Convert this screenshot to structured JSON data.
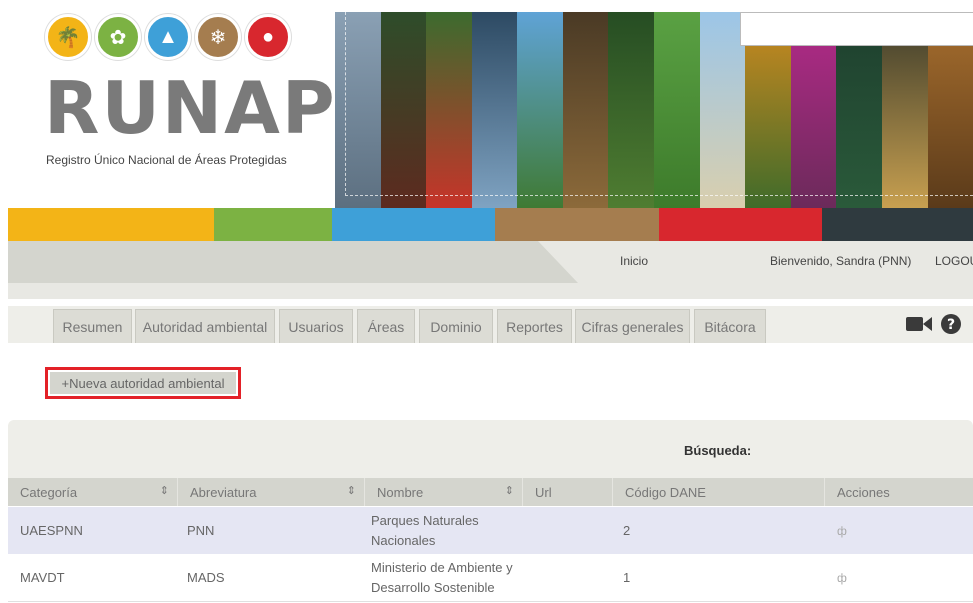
{
  "logo": {
    "word": "RUNAP",
    "subtitle": "Registro Único Nacional de Áreas Protegidas",
    "circle_colors": [
      "#f3b417",
      "#7cb243",
      "#3ea0d8",
      "#a57d4f",
      "#d8272e"
    ],
    "circle_icons": [
      "palm-tree-icon",
      "leaf-icon",
      "mountain-icon",
      "grass-icon",
      "bear-icon"
    ]
  },
  "banner": {
    "strip_colors": [
      "#6f8aa3",
      "#2e4d2a",
      "#3c6b2e",
      "#3d5f7d",
      "#4b8ec0",
      "#6a5a3a",
      "#38612d",
      "#5aa143",
      "#7fb0d6",
      "#c47a1c",
      "#b52a8a",
      "#1e3f2e",
      "#6b4d2a",
      "#d08f3a"
    ]
  },
  "colorbar": [
    "#f3b417",
    "#7cb243",
    "#3ea0d8",
    "#a57d4f",
    "#d8272e",
    "#2f3a3f"
  ],
  "userbar": {
    "home": "Inicio",
    "welcome": "Bienvenido, Sandra (PNN)",
    "logout": "LOGOUT"
  },
  "tabs": [
    "Resumen",
    "Autoridad ambiental",
    "Usuarios",
    "Áreas",
    "Dominio",
    "Reportes",
    "Cifras generales",
    "Bitácora"
  ],
  "actions": {
    "new_button": "+Nueva autoridad ambiental"
  },
  "search": {
    "label": "Búsqueda:",
    "value": ""
  },
  "table": {
    "columns": [
      "Categoría",
      "Abreviatura",
      "Nombre",
      "Url",
      "Código DANE",
      "Acciones"
    ],
    "rows": [
      {
        "categoria": "UAESPNN",
        "abreviatura": "PNN",
        "nombre": "Parques Naturales Nacionales",
        "url": "",
        "codigo": "2",
        "accion": "ф"
      },
      {
        "categoria": "MAVDT",
        "abreviatura": "MADS",
        "nombre": "Ministerio de Ambiente y Desarrollo Sostenible",
        "url": "",
        "codigo": "1",
        "accion": "ф"
      }
    ]
  }
}
